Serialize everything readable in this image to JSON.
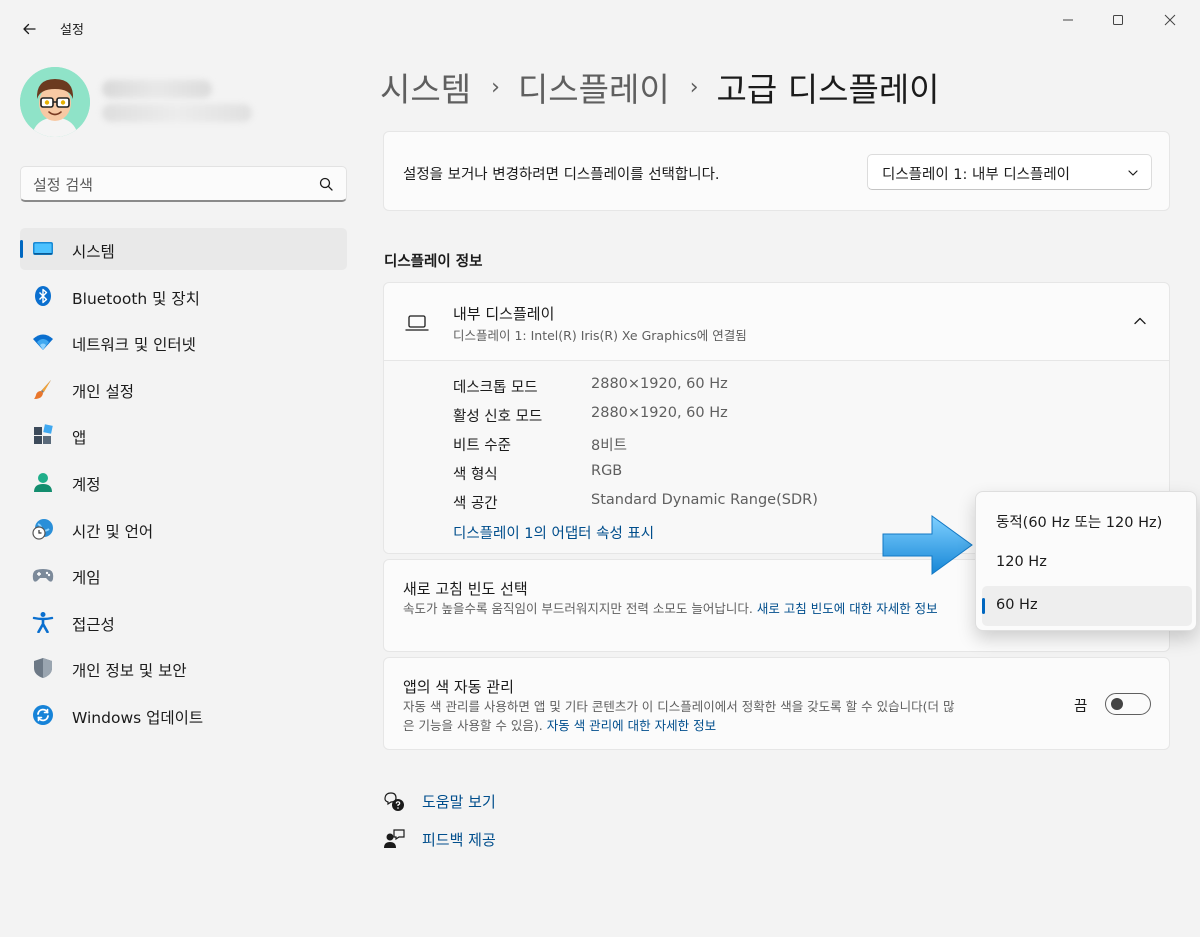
{
  "window": {
    "title": "설정"
  },
  "search": {
    "placeholder": "설정 검색"
  },
  "sidebar": {
    "items": [
      {
        "label": "시스템"
      },
      {
        "label": "Bluetooth 및 장치"
      },
      {
        "label": "네트워크 및 인터넷"
      },
      {
        "label": "개인 설정"
      },
      {
        "label": "앱"
      },
      {
        "label": "계정"
      },
      {
        "label": "시간 및 언어"
      },
      {
        "label": "게임"
      },
      {
        "label": "접근성"
      },
      {
        "label": "개인 정보 및 보안"
      },
      {
        "label": "Windows 업데이트"
      }
    ]
  },
  "breadcrumb": {
    "items": [
      "시스템",
      "디스플레이",
      "고급 디스플레이"
    ]
  },
  "display_select": {
    "text": "설정을 보거나 변경하려면 디스플레이를 선택합니다.",
    "selected": "디스플레이 1: 내부 디스플레이"
  },
  "display_info": {
    "section_title": "디스플레이 정보",
    "title": "내부 디스플레이",
    "subtitle": "디스플레이 1: Intel(R) Iris(R) Xe Graphics에 연결됨",
    "properties": [
      {
        "label": "데스크톱 모드",
        "value": "2880×1920, 60 Hz"
      },
      {
        "label": "활성 신호 모드",
        "value": "2880×1920, 60 Hz"
      },
      {
        "label": "비트 수준",
        "value": "8비트"
      },
      {
        "label": "색 형식",
        "value": "RGB"
      },
      {
        "label": "색 공간",
        "value": "Standard Dynamic Range(SDR)"
      }
    ],
    "adapter_link": "디스플레이 1의 어댑터 속성 표시"
  },
  "refresh_rate": {
    "title": "새로 고침 빈도 선택",
    "desc": "속도가 높을수록 움직임이 부드러워지지만 전력 소모도 늘어납니다.",
    "link": "새로 고침 빈도에 대한 자세한 정보",
    "options": [
      "동적(60 Hz 또는 120 Hz)",
      "120 Hz",
      "60 Hz"
    ],
    "selected": "60 Hz"
  },
  "color_management": {
    "title": "앱의 색 자동 관리",
    "desc": "자동 색 관리를 사용하면 앱 및 기타 콘텐츠가 이 디스플레이에서 정확한 색을 갖도록 할 수 있습니다(더 많은 기능을 사용할 수 있음).",
    "link": "자동 색 관리에 대한 자세한 정보",
    "toggle_label": "끔"
  },
  "help": {
    "get_help": "도움말 보기",
    "feedback": "피드백 제공"
  },
  "colors": {
    "accent": "#0067c0",
    "link": "#004e8c",
    "arrow": "#2fa5e8"
  }
}
